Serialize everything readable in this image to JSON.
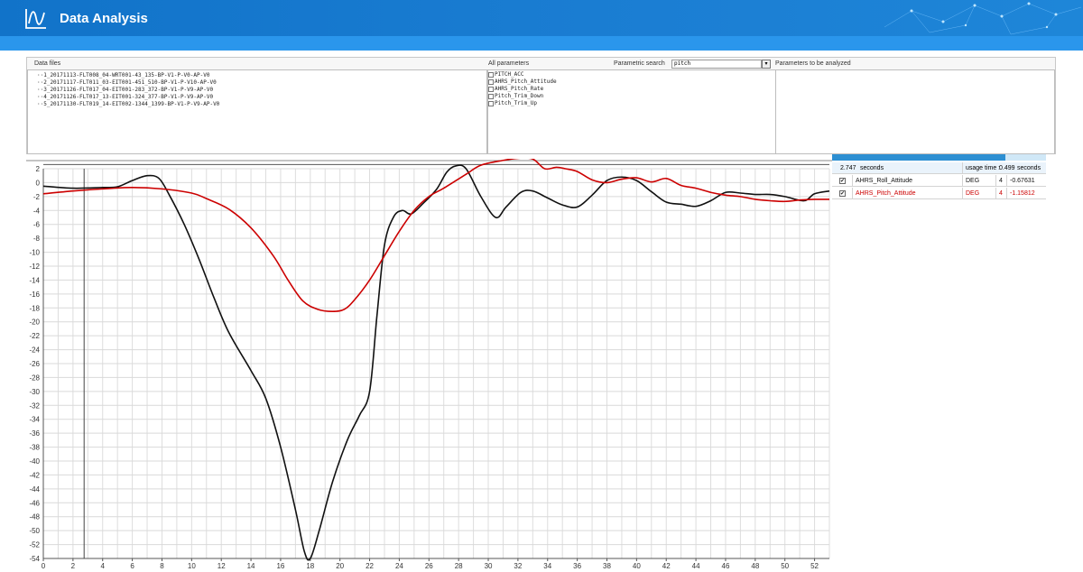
{
  "app": {
    "title": "Data Analysis",
    "colors": {
      "header": "#1173c9",
      "subbar": "#2a96ec"
    },
    "logo_icon": "wave-icon"
  },
  "panels": {
    "data_files": {
      "label": "Data files",
      "items": [
        "1_20171113-FLT008_04-WRT001-43_135-BP-V1-P-V0-AP-V0",
        "2_20171117-FLT011_03-EIT001-451_510-BP-V1-P-V10-AP-V0",
        "3_20171126-FLT017_04-EIT001-283_372-BP-V1-P-V9-AP-V0",
        "4_20171126-FLT017_13-EIT001-324_377-BP-V1-P-V9-AP-V0",
        "5_20171130-FLT019_14-EIT002-1344_1399-BP-V1-P-V9-AP-V0"
      ]
    },
    "all_parameters": {
      "label": "All parameters",
      "search_label": "Parametric search",
      "search_value": "pitch",
      "items": [
        "PITCH_ACC",
        "AHRS_Pitch_Attitude",
        "AHRS_Pitch_Rate",
        "Pitch_Trim_Down",
        "Pitch_Trim_Up"
      ]
    },
    "to_analyze": {
      "label": "Parameters to be analyzed"
    }
  },
  "info": {
    "seconds": "2.747",
    "seconds_unit": "seconds",
    "usage_label": "usage time :",
    "usage_value": "0.499",
    "usage_unit": "seconds",
    "progress": 0.81,
    "rows": [
      {
        "checked": "✔",
        "name": "AHRS_Roll_Attitude",
        "unit": "DEG",
        "count": "4",
        "value": "-0.67631",
        "color": "#111111"
      },
      {
        "checked": "✔",
        "name": "AHRS_Pitch_Attitude",
        "unit": "DEG",
        "count": "4",
        "value": "-1.15812",
        "color": "#cc0000"
      }
    ]
  },
  "chart_data": {
    "type": "line",
    "xlim": [
      0,
      53
    ],
    "ylim": [
      -54,
      2
    ],
    "x_ticks": [
      0,
      2,
      4,
      6,
      8,
      10,
      12,
      14,
      16,
      18,
      20,
      22,
      24,
      26,
      28,
      30,
      32,
      34,
      36,
      38,
      40,
      42,
      44,
      46,
      48,
      50,
      52
    ],
    "y_ticks": [
      2,
      0,
      -2,
      -4,
      -6,
      -8,
      -10,
      -12,
      -14,
      -16,
      -18,
      -20,
      -22,
      -24,
      -26,
      -28,
      -30,
      -32,
      -34,
      -36,
      -38,
      -40,
      -42,
      -44,
      -46,
      -48,
      -50,
      -52,
      -54
    ],
    "cursor_x": 2.75,
    "grid": true,
    "series": [
      {
        "color": "#111111",
        "points": [
          [
            0,
            -0.5
          ],
          [
            2,
            -0.8
          ],
          [
            4,
            -0.7
          ],
          [
            5,
            -0.6
          ],
          [
            6,
            0.3
          ],
          [
            7,
            1.0
          ],
          [
            7.8,
            0.6
          ],
          [
            8.5,
            -1.8
          ],
          [
            9.5,
            -6
          ],
          [
            10.5,
            -11
          ],
          [
            11.5,
            -16.5
          ],
          [
            12.5,
            -21.5
          ],
          [
            14,
            -27
          ],
          [
            15,
            -31
          ],
          [
            16,
            -38
          ],
          [
            17,
            -47
          ],
          [
            17.6,
            -53
          ],
          [
            18,
            -54
          ],
          [
            18.6,
            -50
          ],
          [
            19.5,
            -43
          ],
          [
            20.5,
            -37
          ],
          [
            21.3,
            -33.5
          ],
          [
            22,
            -30
          ],
          [
            22.5,
            -19
          ],
          [
            23,
            -9
          ],
          [
            23.6,
            -5
          ],
          [
            24.2,
            -4
          ],
          [
            24.8,
            -4.5
          ],
          [
            25.6,
            -3
          ],
          [
            26.5,
            -1
          ],
          [
            27.2,
            1.5
          ],
          [
            27.8,
            2.4
          ],
          [
            28.5,
            2
          ],
          [
            29.5,
            -2
          ],
          [
            30.5,
            -5
          ],
          [
            31.2,
            -3.5
          ],
          [
            32.2,
            -1.4
          ],
          [
            33,
            -1.2
          ],
          [
            34,
            -2.2
          ],
          [
            35,
            -3.2
          ],
          [
            36,
            -3.5
          ],
          [
            37,
            -1.8
          ],
          [
            38,
            0.3
          ],
          [
            39,
            0.8
          ],
          [
            40,
            0.3
          ],
          [
            41,
            -1.3
          ],
          [
            42,
            -2.8
          ],
          [
            43,
            -3.1
          ],
          [
            44,
            -3.4
          ],
          [
            45,
            -2.6
          ],
          [
            46,
            -1.4
          ],
          [
            47,
            -1.5
          ],
          [
            48,
            -1.7
          ],
          [
            49,
            -1.7
          ],
          [
            50,
            -2.0
          ],
          [
            51.3,
            -2.6
          ],
          [
            52,
            -1.6
          ],
          [
            53,
            -1.2
          ]
        ]
      },
      {
        "color": "#cc0000",
        "points": [
          [
            0,
            -1.6
          ],
          [
            2,
            -1.2
          ],
          [
            4,
            -0.9
          ],
          [
            6,
            -0.7
          ],
          [
            8,
            -0.9
          ],
          [
            10,
            -1.5
          ],
          [
            11,
            -2.3
          ],
          [
            12.5,
            -3.8
          ],
          [
            14,
            -6.5
          ],
          [
            15.5,
            -10.5
          ],
          [
            16.5,
            -14
          ],
          [
            17.5,
            -17
          ],
          [
            18.5,
            -18.2
          ],
          [
            19.5,
            -18.5
          ],
          [
            20.3,
            -18.2
          ],
          [
            21,
            -16.8
          ],
          [
            22,
            -14
          ],
          [
            23,
            -10.5
          ],
          [
            24,
            -7
          ],
          [
            25,
            -4
          ],
          [
            26,
            -2
          ],
          [
            27,
            -0.8
          ],
          [
            28.5,
            1.2
          ],
          [
            29.5,
            2.5
          ],
          [
            31,
            3.2
          ],
          [
            32,
            3.5
          ],
          [
            33,
            3.4
          ],
          [
            33.8,
            2.0
          ],
          [
            34.6,
            2.2
          ],
          [
            35.2,
            2.0
          ],
          [
            36,
            1.6
          ],
          [
            37,
            0.4
          ],
          [
            38,
            0.0
          ],
          [
            39,
            0.5
          ],
          [
            40,
            0.7
          ],
          [
            41,
            0.1
          ],
          [
            42,
            0.6
          ],
          [
            43,
            -0.4
          ],
          [
            44,
            -0.8
          ],
          [
            45,
            -1.4
          ],
          [
            46,
            -1.8
          ],
          [
            47,
            -2.0
          ],
          [
            48,
            -2.4
          ],
          [
            49,
            -2.6
          ],
          [
            50,
            -2.7
          ],
          [
            51,
            -2.5
          ],
          [
            52,
            -2.4
          ],
          [
            53,
            -2.4
          ]
        ]
      }
    ]
  }
}
